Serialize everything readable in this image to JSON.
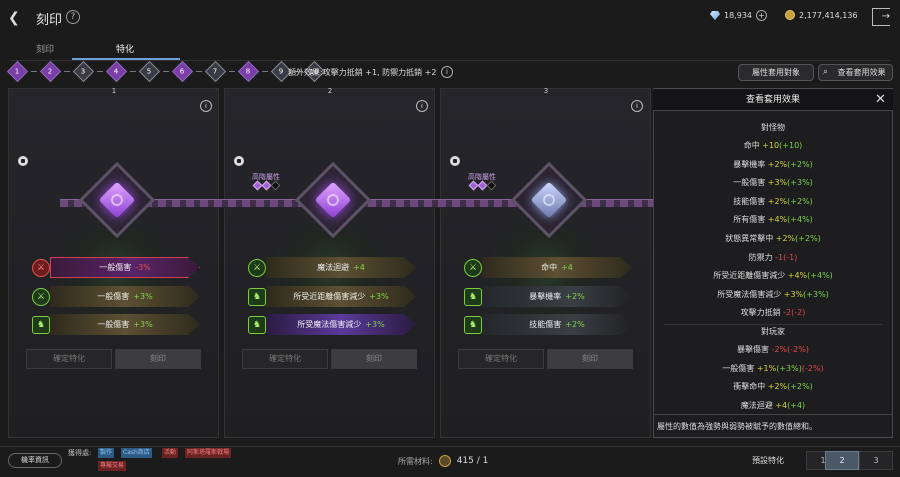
{
  "header": {
    "back_icon": "chevron-left-icon",
    "title": "刻印",
    "help_icon": "question-icon",
    "diamonds": "18,934",
    "gold": "2,177,414,136",
    "exit_icon": "exit-icon"
  },
  "tabs": [
    {
      "label": "刻印"
    },
    {
      "label": "特化"
    }
  ],
  "progress": {
    "nodes": [
      "1",
      "2",
      "3",
      "4",
      "5",
      "6",
      "7",
      "8",
      "9",
      "10"
    ],
    "filled": [
      true,
      true,
      false,
      true,
      false,
      true,
      false,
      true,
      false,
      false
    ],
    "bonus": "額外效果:攻擊力抵銷 +1, 防禦力抵銷 +2"
  },
  "buttons": {
    "apply_attr": "屬性套用對象",
    "view_effects": "查看套用效果"
  },
  "columns": [
    {
      "num": "1",
      "tier_label": "",
      "effects": [
        {
          "name": "一般傷害",
          "value": "-3%",
          "tone": "r"
        },
        {
          "name": "一般傷害",
          "value": "+3%",
          "tone": "g"
        },
        {
          "name": "一般傷害",
          "value": "+3%",
          "tone": "g"
        }
      ],
      "confirm": "確定特化",
      "engrave": "刻印"
    },
    {
      "num": "2",
      "tier_label": "高階屬性",
      "effects": [
        {
          "name": "魔法迴避",
          "value": "+4",
          "tone": "g"
        },
        {
          "name": "所受近距離傷害減少",
          "value": "+3%",
          "tone": "g"
        },
        {
          "name": "所受魔法傷害減少",
          "value": "+3%",
          "tone": "g"
        }
      ],
      "confirm": "確定特化",
      "engrave": "刻印"
    },
    {
      "num": "3",
      "tier_label": "高階屬性",
      "effects": [
        {
          "name": "命中",
          "value": "+4",
          "tone": "g"
        },
        {
          "name": "暴擊機率",
          "value": "+2%",
          "tone": "g"
        },
        {
          "name": "技能傷害",
          "value": "+2%",
          "tone": "g"
        }
      ],
      "confirm": "確定特化",
      "engrave": "刻印"
    }
  ],
  "panel": {
    "title": "查看套用效果",
    "sections": [
      {
        "title": "對怪物",
        "lines": [
          {
            "label": "命中",
            "val": "+10",
            "paren": "(+10)",
            "neg": false
          },
          {
            "label": "暴擊機率",
            "val": "+2%",
            "paren": "(+2%)",
            "neg": false
          },
          {
            "label": "一般傷害",
            "val": "+3%",
            "paren": "(+3%)",
            "neg": false
          },
          {
            "label": "技能傷害",
            "val": "+2%",
            "paren": "(+2%)",
            "neg": false
          },
          {
            "label": "所有傷害",
            "val": "+4%",
            "paren": "(+4%)",
            "neg": false
          },
          {
            "label": "狀態異常擊中",
            "val": "+2%",
            "paren": "(+2%)",
            "neg": false
          },
          {
            "label": "防禦力",
            "val": "-1",
            "paren": "(-1)",
            "neg": true
          },
          {
            "label": "所受近距離傷害減少",
            "val": "+4%",
            "paren": "(+4%)",
            "neg": false
          },
          {
            "label": "所受魔法傷害減少",
            "val": "+3%",
            "paren": "(+3%)",
            "neg": false
          },
          {
            "label": "攻擊力抵銷",
            "val": "-2",
            "paren": "(-2)",
            "neg": true
          }
        ]
      },
      {
        "title": "對玩家",
        "lines": [
          {
            "label": "暴擊傷害",
            "val": "-2%",
            "paren": "(-2%)",
            "neg": true
          },
          {
            "label": "一般傷害",
            "val": "+1%",
            "paren": "(+3%)",
            "neg": false,
            "extra": "(-2%)"
          },
          {
            "label": "衝擊命中",
            "val": "+2%",
            "paren": "(+2%)",
            "neg": false
          },
          {
            "label": "魔法迴避",
            "val": "+4",
            "paren": "(+4)",
            "neg": false
          }
        ]
      }
    ],
    "footer": "屬性的數值為強勢與弱勢被賦予的數值總和。"
  },
  "bottom": {
    "prob": "機率資訊",
    "source_label": "獲得處:",
    "sources": [
      {
        "t": "製作",
        "c": "blue"
      },
      {
        "t": "Cash商店",
        "c": "blue"
      },
      {
        "t": "活動",
        "c": "red"
      },
      {
        "t": "阿斯塔羅斯戰場",
        "c": "red"
      },
      {
        "t": "專屬交易",
        "c": "red"
      }
    ],
    "req_label": "所需材料:",
    "req_val": "415 / 1",
    "preset_label": "預設特化",
    "presets": [
      "1",
      "2",
      "3"
    ],
    "preset_active": 2
  }
}
